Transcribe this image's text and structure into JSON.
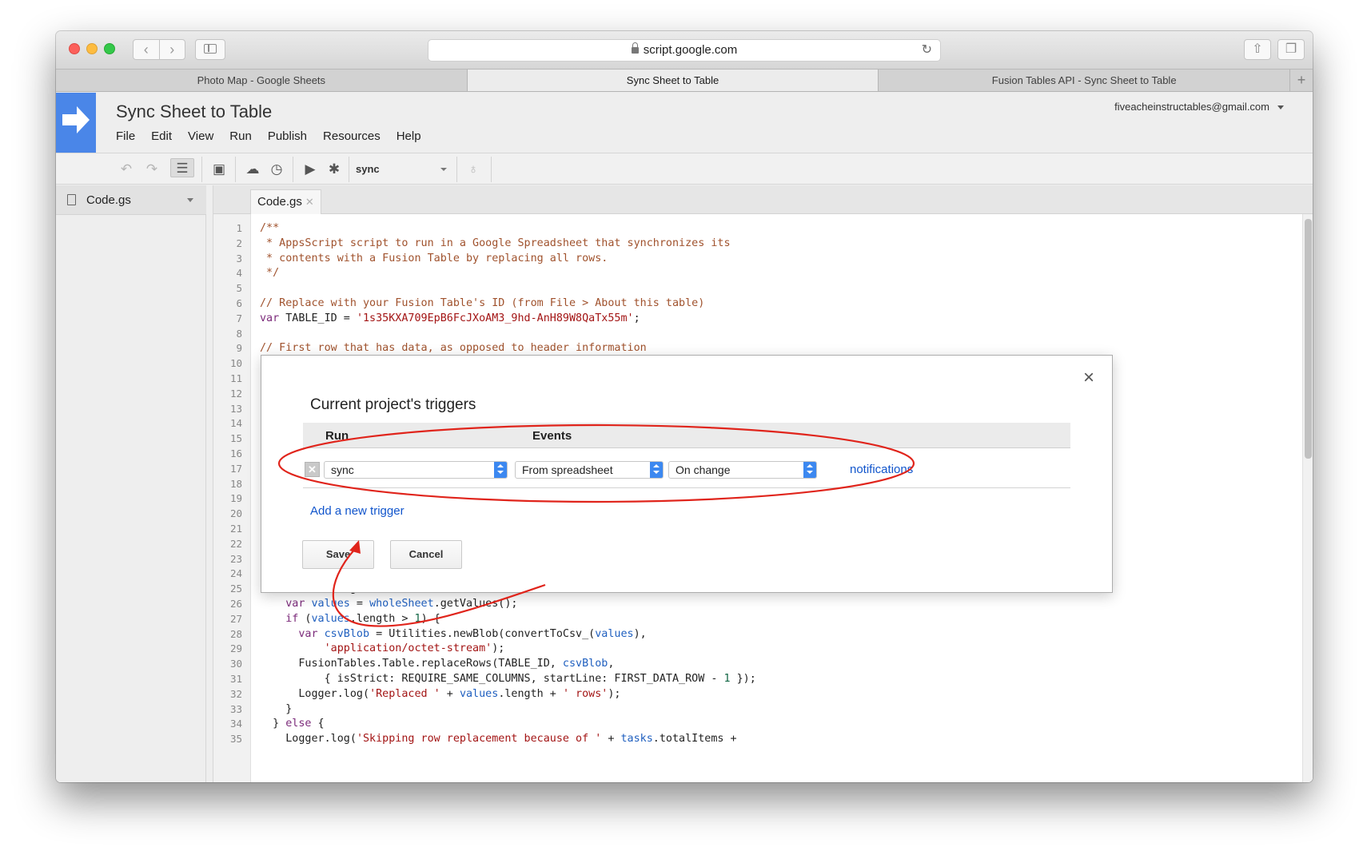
{
  "browser": {
    "url": "script.google.com",
    "tabs": [
      "Photo Map - Google Sheets",
      "Sync Sheet to Table",
      "Fusion Tables API - Sync Sheet to Table"
    ],
    "active_tab": 1,
    "new_tab_label": "+"
  },
  "app": {
    "title": "Sync Sheet to Table",
    "account": "fiveacheinstructables@gmail.com",
    "menu": [
      "File",
      "Edit",
      "View",
      "Run",
      "Publish",
      "Resources",
      "Help"
    ],
    "function_select": "sync"
  },
  "sidebar": {
    "file": "Code.gs"
  },
  "editor": {
    "tab": "Code.gs",
    "line_numbers": [
      "1",
      "2",
      "3",
      "4",
      "5",
      "6",
      "7",
      "8",
      "9",
      "10",
      "11",
      "12",
      "13",
      "14",
      "15",
      "16",
      "17",
      "18",
      "19",
      "20",
      "21",
      "22",
      "23",
      "24",
      "25",
      "26",
      "27",
      "28",
      "29",
      "30",
      "31",
      "32",
      "33",
      "34",
      "35"
    ]
  },
  "dialog": {
    "title": "Current project's triggers",
    "headers": {
      "run": "Run",
      "events": "Events"
    },
    "trigger": {
      "function": "sync",
      "source": "From spreadsheet",
      "event": "On change",
      "notifications_label": "notifications"
    },
    "add_trigger_label": "Add a new trigger",
    "save_label": "Save",
    "cancel_label": "Cancel",
    "close_label": "×",
    "delete_label": "✕"
  },
  "colors": {
    "accent": "#4a86e8",
    "link": "#1155cc",
    "annotation": "#e0241b",
    "stepper": "#3c88f0"
  }
}
